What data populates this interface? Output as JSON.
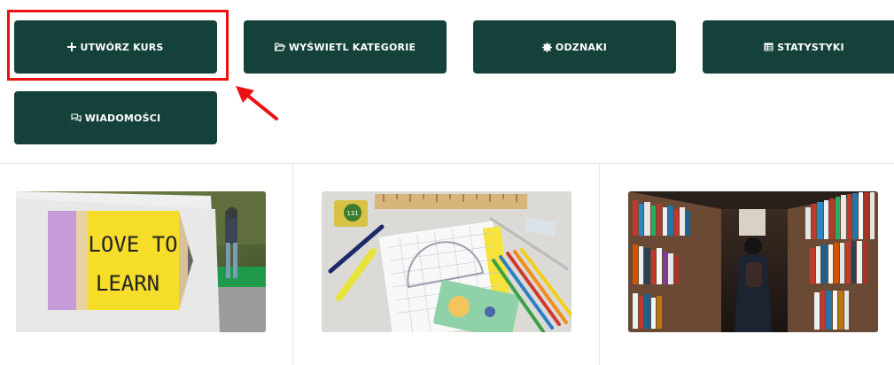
{
  "buttons": {
    "create_course": "UTWÓRZ KURS",
    "view_categories": "WYŚWIETL KATEGORIE",
    "badges": "ODZNAKI",
    "statistics": "STATYSTYKI",
    "messages": "WIADOMOŚCI"
  },
  "icons": {
    "create_course": "plus-icon",
    "view_categories": "folder-open-icon",
    "badges": "badge-icon",
    "statistics": "table-icon",
    "messages": "chat-icon"
  },
  "cards": [
    {
      "image": "love-to-learn-pencil-sign",
      "sign_text": [
        "LOVE TO",
        "LEARN"
      ]
    },
    {
      "image": "school-supplies-desk",
      "sticker_text": "131"
    },
    {
      "image": "library-bookshelves"
    }
  ],
  "colors": {
    "button_bg": "#14413a",
    "button_text": "#ffffff",
    "highlight": "#ee1111"
  }
}
